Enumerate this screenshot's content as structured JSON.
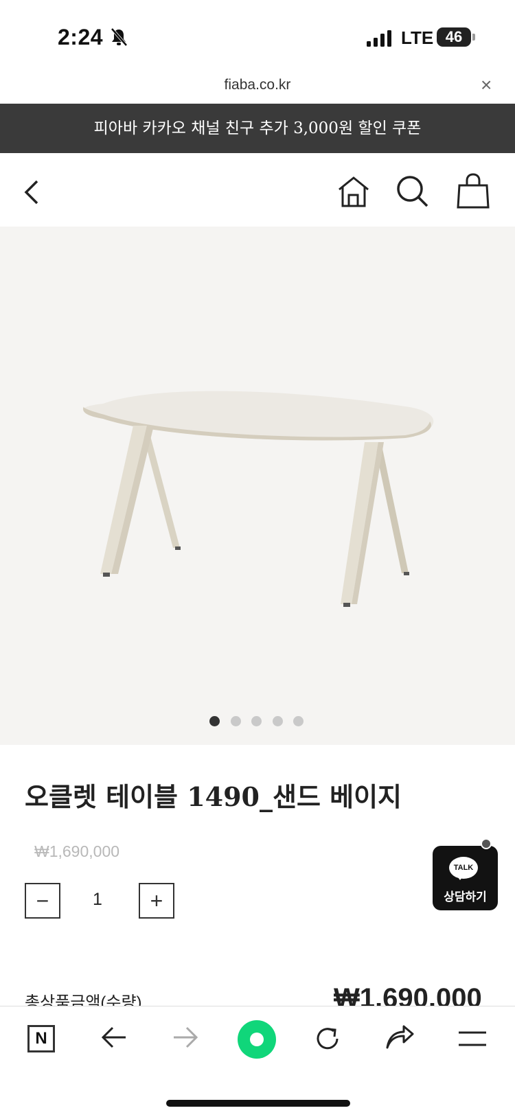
{
  "status": {
    "time": "2:24",
    "network": "LTE",
    "battery": "46"
  },
  "browser": {
    "url": "fiaba.co.kr",
    "close_label": "×"
  },
  "promo": {
    "text": "피아바 카카오 채널 친구 추가 3,000원 할인 쿠폰"
  },
  "gallery": {
    "slide_count": 5,
    "active_index": 0
  },
  "product": {
    "title": "오클렛 테이블 1490_샌드 베이지",
    "price": "₩1,690,000",
    "quantity": "1",
    "minus_label": "−",
    "plus_label": "+"
  },
  "talk": {
    "bubble": "TALK",
    "label": "상담하기"
  },
  "summary": {
    "total_label": "총상품금액(수량)",
    "total_price": "₩1,690,000"
  },
  "toolbar": {
    "naver_label": "N"
  },
  "colors": {
    "promo_bg": "#3a3a3a",
    "accent_green": "#10d67a",
    "image_bg": "#f5f4f2"
  }
}
